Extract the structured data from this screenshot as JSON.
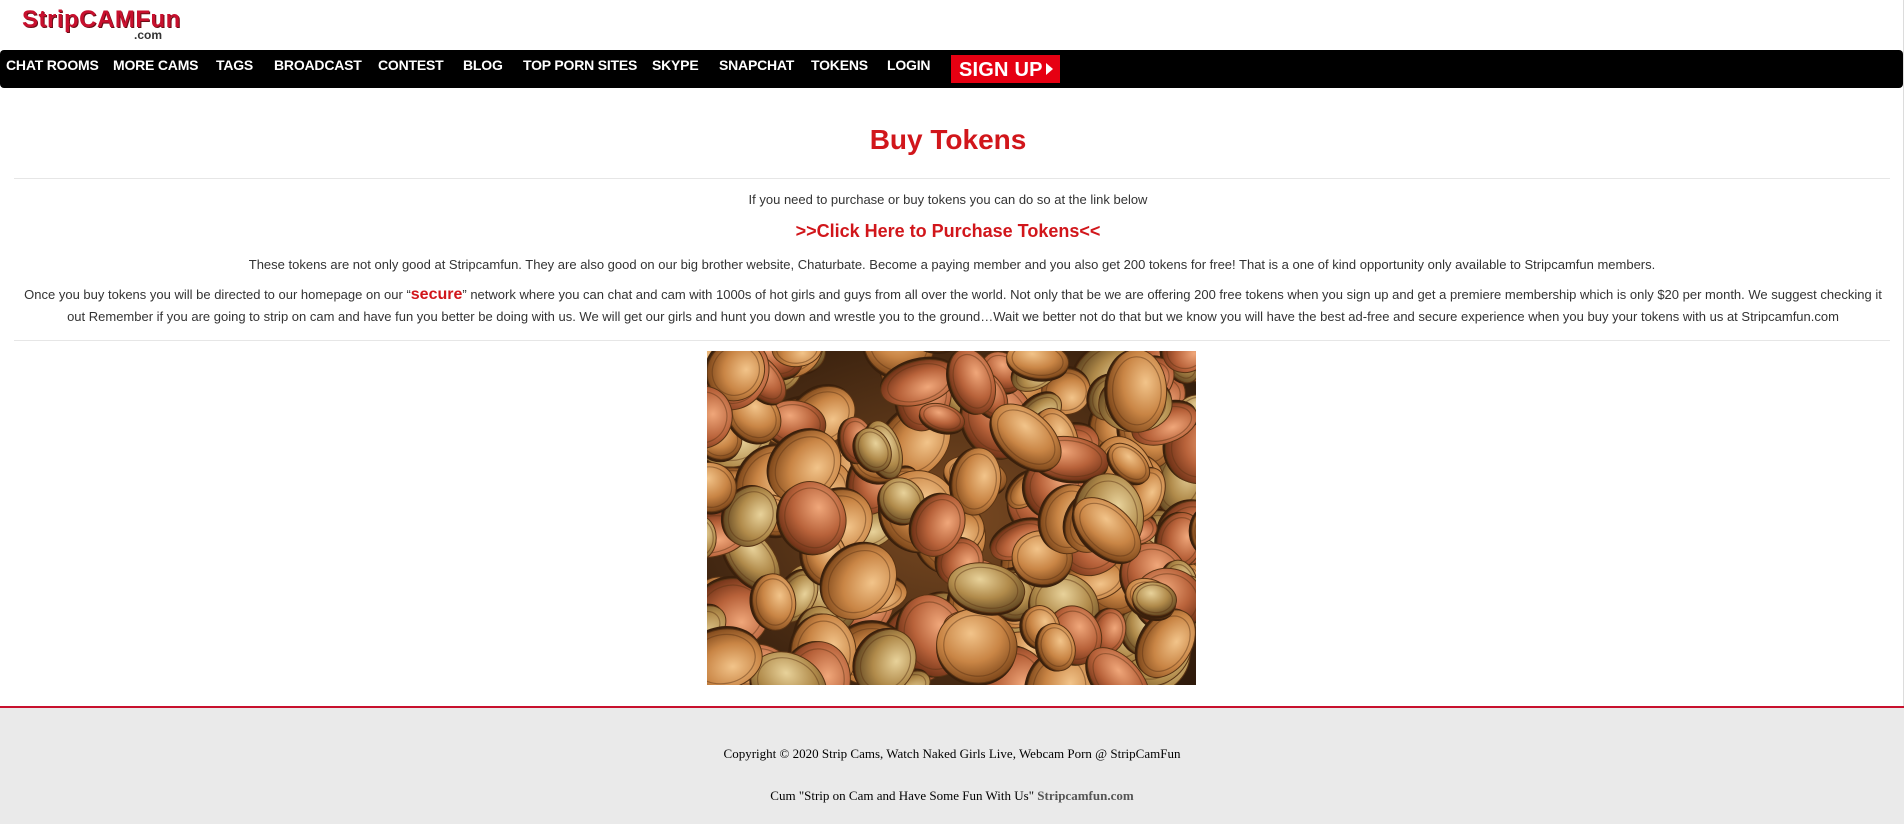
{
  "logo": {
    "text": "StripCAMFun",
    "suffix": ".com"
  },
  "nav": {
    "items": [
      {
        "label": "CHAT ROOMS"
      },
      {
        "label": "MORE CAMS"
      },
      {
        "label": "TAGS"
      },
      {
        "label": "BROADCAST"
      },
      {
        "label": "CONTEST"
      },
      {
        "label": "BLOG"
      },
      {
        "label": "TOP PORN SITES"
      },
      {
        "label": "SKYPE"
      },
      {
        "label": "SNAPCHAT"
      },
      {
        "label": "TOKENS"
      },
      {
        "label": "LOGIN"
      }
    ],
    "signup_label": "SIGN UP"
  },
  "main": {
    "title": "Buy Tokens",
    "intro": "If you need to purchase or buy tokens you can do so at the link below",
    "purchase_link": ">>Click Here to Purchase Tokens<<",
    "paragraph2": "These tokens are not only good at Stripcamfun. They are also good on our big brother website, Chaturbate. Become a paying member and you also get 200 tokens for free! That is a one of kind opportunity only available to Stripcamfun members.",
    "paragraph3_before": "Once you buy tokens you will be directed to our homepage on our “",
    "paragraph3_highlight": "secure",
    "paragraph3_after": "” network where you can chat and cam with 1000s of hot girls and guys from all over the world. Not only that be we are offering 200 free tokens when you sign up and get a premiere membership which is only $20 per month. We suggest checking it out Remember if you are going to strip on cam and have fun you better be doing with us. We will get our girls and hunt you down and wrestle you to the ground…Wait we better not do that but we know you will have the best ad-free and secure experience when you buy your tokens with us at Stripcamfun.com"
  },
  "footer": {
    "copyright": "Copyright © 2020 Strip Cams, Watch Naked Girls Live, Webcam Porn @ StripCamFun",
    "tagline": "Cum \"Strip on Cam and Have Some Fun With Us\"",
    "site_link": "Stripcamfun.com"
  },
  "colors": {
    "accent": "#d1161b",
    "nav_bg": "#000000",
    "signup_bg": "#e60012",
    "footer_bg": "#eaeaea"
  }
}
